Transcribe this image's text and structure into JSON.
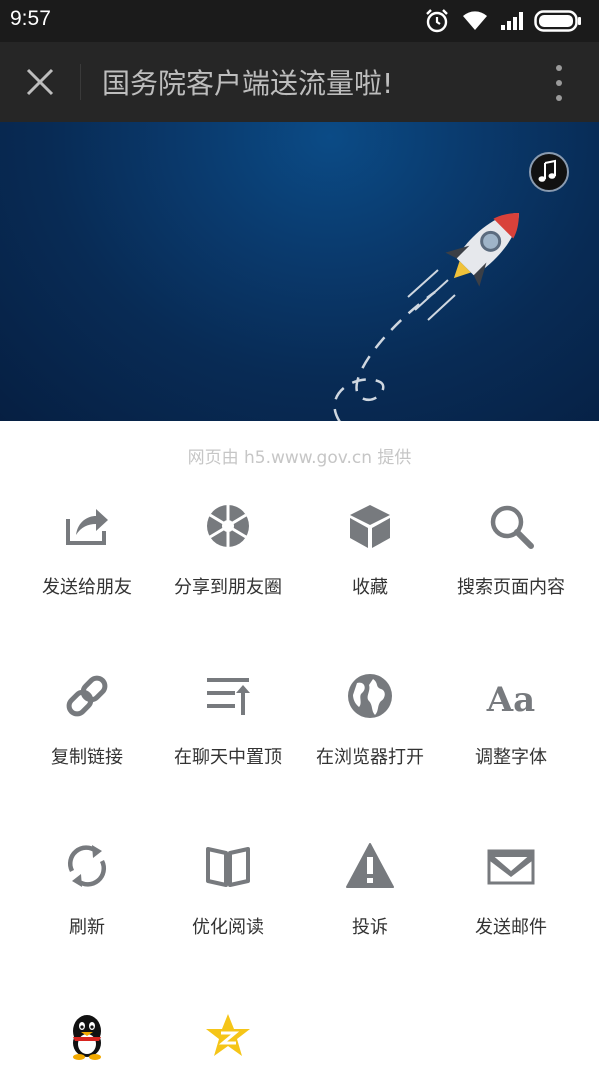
{
  "status_bar": {
    "time": "9:57"
  },
  "header": {
    "title": "国务院客户端送流量啦!"
  },
  "provider_text": "网页由 h5.www.gov.cn 提供",
  "menu": {
    "row1": [
      "发送给朋友",
      "分享到朋友圈",
      "收藏",
      "搜索页面内容"
    ],
    "row2": [
      "复制链接",
      "在聊天中置顶",
      "在浏览器打开",
      "调整字体"
    ],
    "row3": [
      "刷新",
      "优化阅读",
      "投诉",
      "发送邮件"
    ]
  },
  "icon_font_text": "Aa",
  "colors": {
    "icon_gray": "#777a7e",
    "accent_yellow": "#f5c518"
  }
}
